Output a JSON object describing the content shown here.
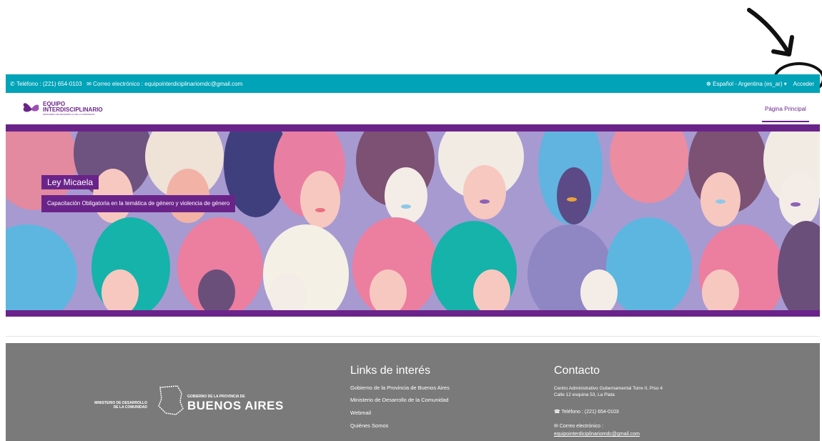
{
  "topbar": {
    "phone": "Teléfono : (221) 654-0103",
    "email": "Correo electrónico : equipointerdiciplinariomdc@gmail.com",
    "language": "Español - Argentina (es_ar)",
    "login": "Acceder"
  },
  "navbar": {
    "logo_line1": "EQUIPO",
    "logo_line2": "INTERDISCIPLINARIO",
    "logo_sub": "MINISTERIO DE DESARROLLO DE LA COMUNIDAD",
    "home": "Página Principal"
  },
  "hero": {
    "title": "Ley Micaela",
    "subtitle": "Capacitación Obligatoria en la temática de género y violencia de género"
  },
  "footer": {
    "logo_ministry": "MINISTERIO DE DESARROLLO DE LA COMUNIDAD",
    "logo_gov_small": "GOBIERNO DE LA PROVINCIA DE",
    "logo_gov_big": "BUENOS AIRES",
    "links_title": "Links de interés",
    "links": [
      "Gobierno de la Provincia de Buenos Aires",
      "Ministerio de Desarrollo de la Comunidad",
      "Webmail",
      "Quiénes Somos"
    ],
    "contact_title": "Contacto",
    "address_line1": "Centro Administrativo Gubernamental Torre II, Piso 4",
    "address_line2": "Calle 12 esquina 53, La Plata",
    "phone": "Teléfono : (221) 654-0103",
    "email_label": "Correo electrónico :",
    "email": "equipointerdiciplinariomdc@gmail.com"
  },
  "colors": {
    "topbar": "#00a3b8",
    "brand_purple": "#6a2489",
    "footer": "#7a7a7a"
  }
}
